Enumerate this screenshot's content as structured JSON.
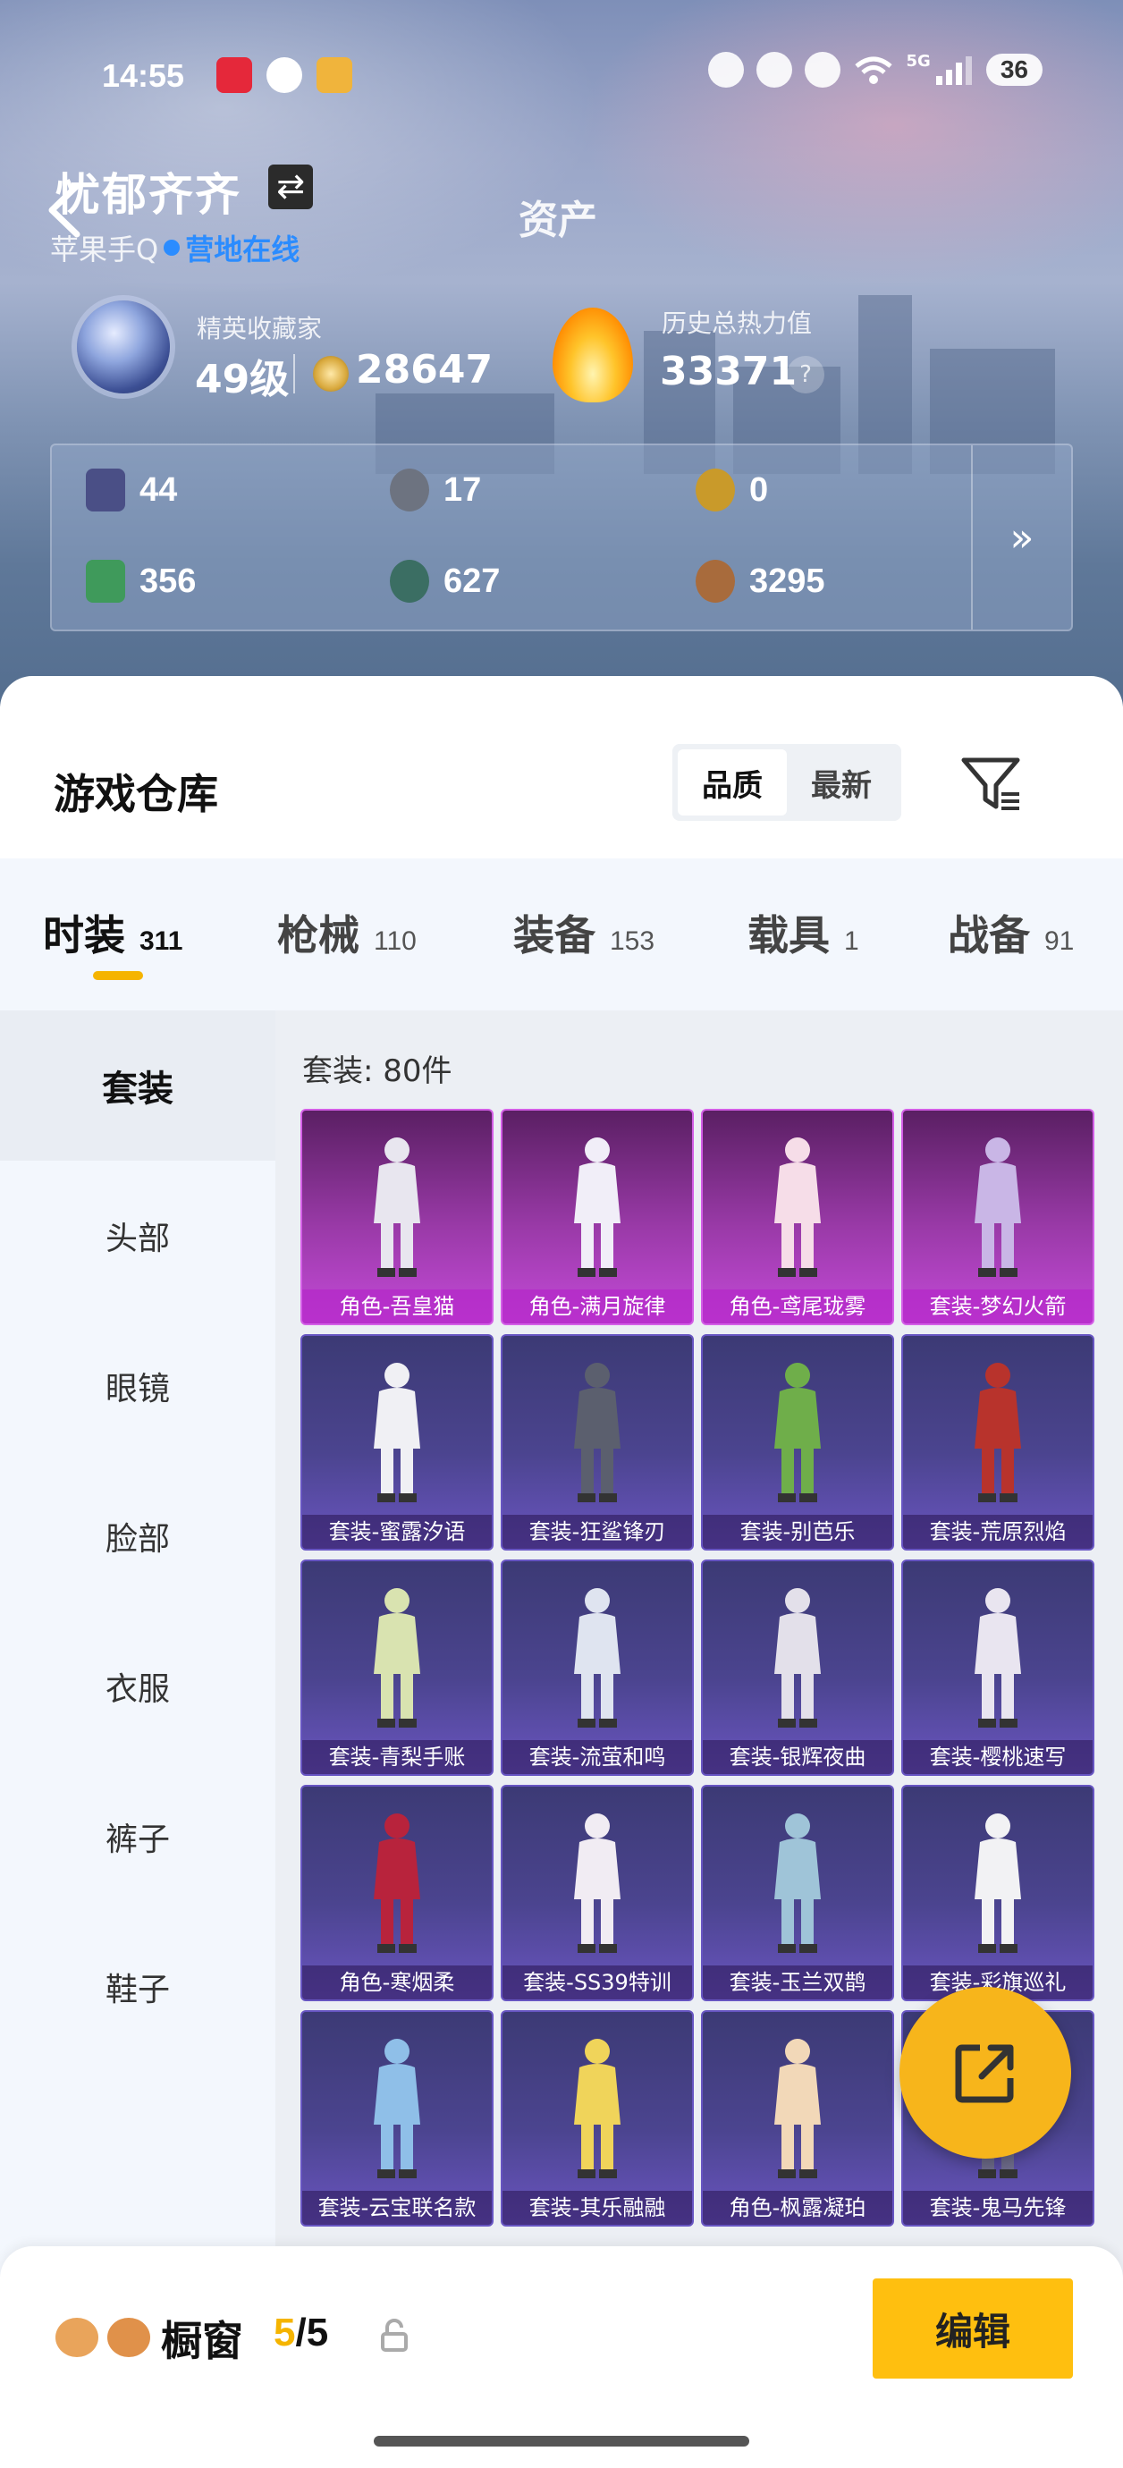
{
  "status_bar": {
    "time": "14:55",
    "network": "5G",
    "battery": "36"
  },
  "header": {
    "user_name": "忧郁齐齐",
    "swap_icon": "⇄",
    "page_title": "资产",
    "platform": "苹果手Q",
    "online_status": "营地在线"
  },
  "stats": {
    "rank_label": "精英收藏家",
    "rank_level": "49级",
    "coin_value": "28647",
    "heat_label": "历史总热力值",
    "heat_value": "33371",
    "help_mark": "?"
  },
  "currencies": [
    {
      "value": "44",
      "icon": "card-pack-icon",
      "color": "#4a4f86"
    },
    {
      "value": "17",
      "icon": "silver-coin-icon",
      "color": "#6d7380"
    },
    {
      "value": "0",
      "icon": "gold-token-icon",
      "color": "#c99a2a"
    },
    {
      "value": "356",
      "icon": "green-ticket-icon",
      "color": "#3f9a5b"
    },
    {
      "value": "627",
      "icon": "jade-coin-icon",
      "color": "#3b6e63"
    },
    {
      "value": "3295",
      "icon": "bronze-coin-icon",
      "color": "#a86b3c"
    }
  ],
  "currency_more": "»",
  "warehouse": {
    "title": "游戏仓库",
    "sort_options": [
      "品质",
      "最新"
    ],
    "active_sort": 0
  },
  "categories": [
    {
      "label": "时装",
      "count": "311"
    },
    {
      "label": "枪械",
      "count": "110"
    },
    {
      "label": "装备",
      "count": "153"
    },
    {
      "label": "载具",
      "count": "1"
    },
    {
      "label": "战备",
      "count": "91"
    }
  ],
  "sidebar": [
    "套装",
    "头部",
    "眼镜",
    "脸部",
    "衣服",
    "裤子",
    "鞋子"
  ],
  "grid": {
    "count_label": "套装: 80件",
    "items": [
      {
        "label": "角色-吾皇猫",
        "rarity": "pink"
      },
      {
        "label": "角色-满月旋律",
        "rarity": "pink"
      },
      {
        "label": "角色-鸢尾珑雾",
        "rarity": "pink"
      },
      {
        "label": "套装-梦幻火箭",
        "rarity": "pink"
      },
      {
        "label": "套装-蜜露汐语",
        "rarity": "purple"
      },
      {
        "label": "套装-狂鲨锋刃",
        "rarity": "purple"
      },
      {
        "label": "套装-别芭乐",
        "rarity": "purple"
      },
      {
        "label": "套装-荒原烈焰",
        "rarity": "purple"
      },
      {
        "label": "套装-青梨手账",
        "rarity": "purple"
      },
      {
        "label": "套装-流萤和鸣",
        "rarity": "purple"
      },
      {
        "label": "套装-银辉夜曲",
        "rarity": "purple"
      },
      {
        "label": "套装-樱桃速写",
        "rarity": "purple"
      },
      {
        "label": "角色-寒烟柔",
        "rarity": "purple"
      },
      {
        "label": "套装-SS39特训",
        "rarity": "purple"
      },
      {
        "label": "套装-玉兰双鹊",
        "rarity": "purple"
      },
      {
        "label": "套装-彩旗巡礼",
        "rarity": "purple"
      },
      {
        "label": "套装-云宝联名款",
        "rarity": "purple"
      },
      {
        "label": "套装-其乐融融",
        "rarity": "purple"
      },
      {
        "label": "角色-枫露凝珀",
        "rarity": "purple"
      },
      {
        "label": "套装-鬼马先锋",
        "rarity": "purple"
      }
    ]
  },
  "showcase": {
    "title": "橱窗",
    "used": "5",
    "total": "/5",
    "edit_label": "编辑"
  }
}
